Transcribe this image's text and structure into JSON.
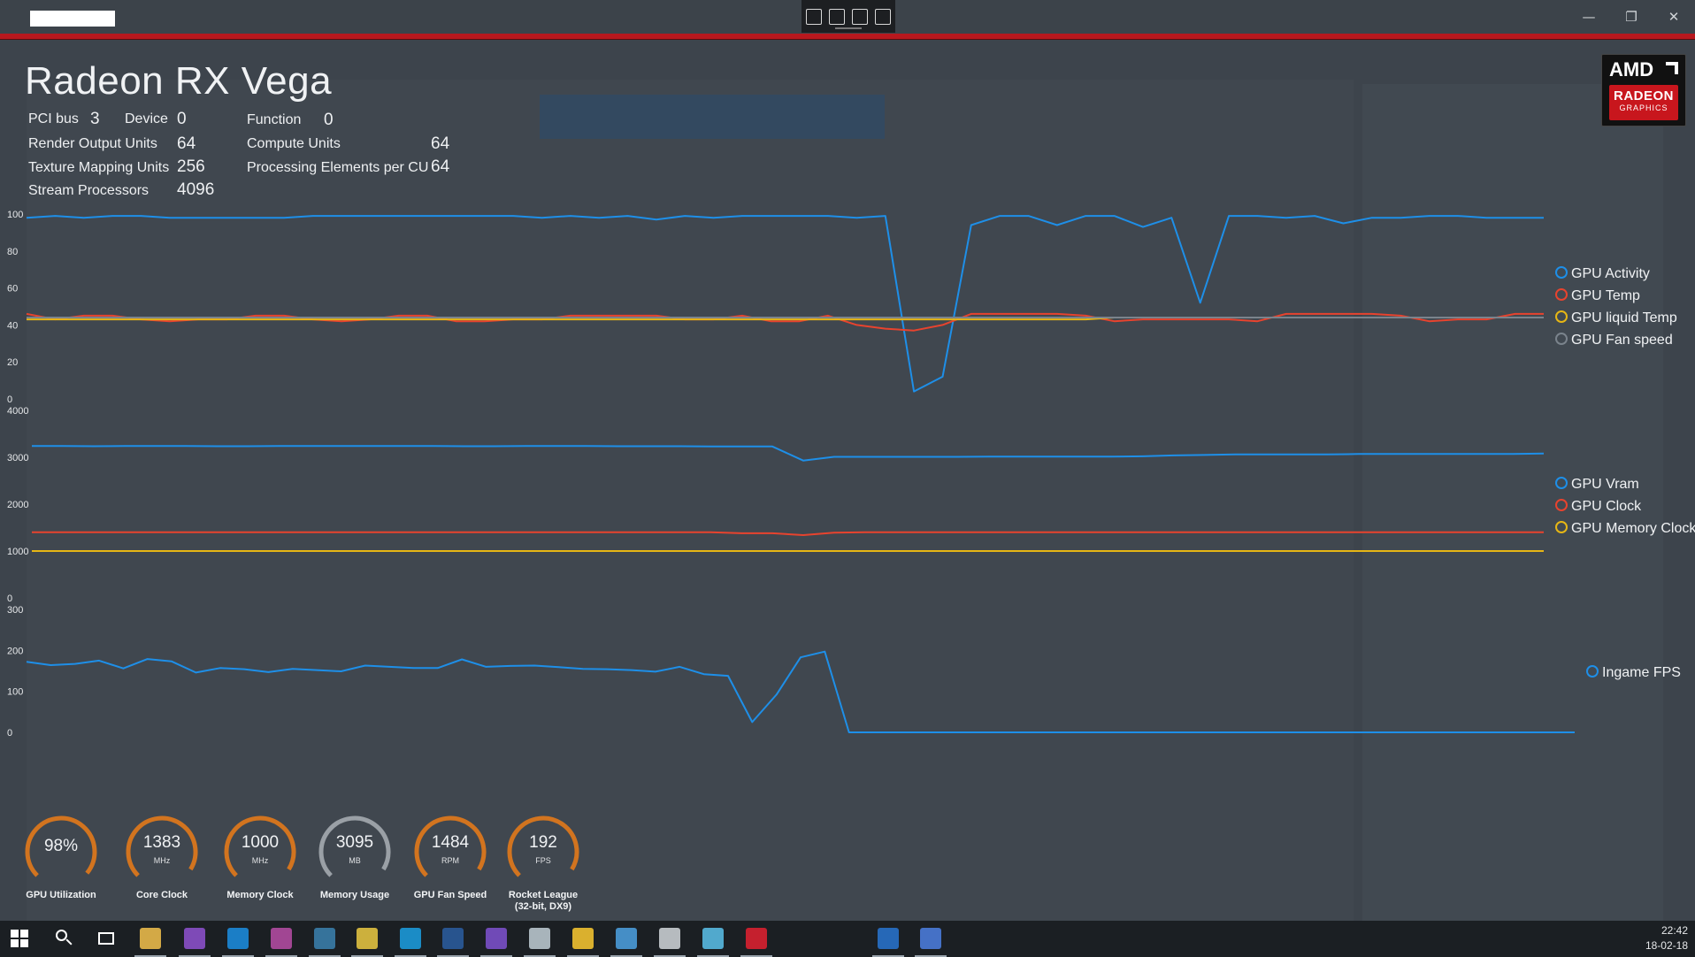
{
  "window": {
    "title": ""
  },
  "header": {
    "gpu_name": "Radeon RX Vega"
  },
  "specs": {
    "pci_bus_label": "PCI bus",
    "pci_bus": "3",
    "device_label": "Device",
    "device": "0",
    "function_label": "Function",
    "function": "0",
    "rop_label": "Render Output Units",
    "rop": "64",
    "cu_label": "Compute Units",
    "cu": "64",
    "tmu_label": "Texture Mapping Units",
    "tmu": "256",
    "pe_label": "Processing Elements per CU",
    "pe": "64",
    "sp_label": "Stream Processors",
    "sp": "4096"
  },
  "logo": {
    "brand": "AMD",
    "product": "RADEON",
    "sub": "GRAPHICS"
  },
  "colors": {
    "blue": "#1e8fe8",
    "red": "#e8432e",
    "yellow": "#e6b615",
    "gray": "#7a838c",
    "gauge_orange": "#d2741f",
    "gauge_gray": "#9aa0a6"
  },
  "chart_data": [
    {
      "type": "line",
      "ylim": [
        0,
        100
      ],
      "yticks": [
        "100",
        "80",
        "60",
        "40",
        "20",
        "0"
      ],
      "series": [
        {
          "name": "GPU Activity",
          "color": "blue",
          "values": [
            98,
            99,
            98,
            99,
            99,
            98,
            98,
            98,
            98,
            98,
            99,
            99,
            99,
            99,
            99,
            99,
            99,
            99,
            98,
            99,
            98,
            99,
            97,
            99,
            98,
            99,
            99,
            99,
            99,
            98,
            99,
            4,
            12,
            94,
            99,
            99,
            94,
            99,
            99,
            93,
            98,
            52,
            99,
            99,
            98,
            99,
            95,
            98,
            98,
            99,
            99,
            98,
            98,
            98
          ]
        },
        {
          "name": "GPU Temp",
          "color": "red",
          "values": [
            46,
            43,
            45,
            45,
            43,
            42,
            43,
            43,
            45,
            45,
            43,
            42,
            43,
            45,
            45,
            42,
            42,
            43,
            43,
            45,
            45,
            45,
            45,
            43,
            43,
            45,
            42,
            42,
            45,
            40,
            38,
            37,
            40,
            46,
            46,
            46,
            46,
            45,
            42,
            43,
            43,
            43,
            43,
            42,
            46,
            46,
            46,
            46,
            45,
            42,
            43,
            43,
            46,
            46
          ]
        },
        {
          "name": "GPU liquid Temp",
          "color": "yellow",
          "values": [
            43,
            43,
            43,
            43,
            43,
            43,
            43,
            43,
            43,
            43,
            43,
            43,
            43,
            43,
            43,
            43,
            43,
            43,
            43,
            43,
            43,
            43,
            43,
            43,
            43,
            43,
            43,
            43,
            43,
            43,
            43,
            43,
            43,
            43,
            43,
            43,
            43,
            43,
            44,
            44,
            44,
            44,
            44,
            44,
            44,
            44,
            44,
            44,
            44,
            44,
            44,
            44,
            44,
            44
          ]
        },
        {
          "name": "GPU Fan speed",
          "color": "gray",
          "values": [
            44,
            44,
            44,
            44,
            44,
            44,
            44,
            44,
            44,
            44,
            44,
            44,
            44,
            44,
            44,
            44,
            44,
            44,
            44,
            44,
            44,
            44,
            44,
            44,
            44,
            44,
            44,
            44,
            44,
            44,
            44,
            44,
            44,
            44,
            44,
            44,
            44,
            44,
            44,
            44,
            44,
            44,
            44,
            44,
            44,
            44,
            44,
            44,
            44,
            44,
            44,
            44,
            44,
            44
          ]
        }
      ]
    },
    {
      "type": "line",
      "ylim": [
        0,
        4000
      ],
      "yticks": [
        "4000",
        "3000",
        "2000",
        "1000",
        "0"
      ],
      "series": [
        {
          "name": "GPU Vram",
          "color": "blue",
          "values": [
            3240,
            3240,
            3235,
            3240,
            3240,
            3240,
            3235,
            3235,
            3240,
            3240,
            3240,
            3240,
            3240,
            3240,
            3235,
            3235,
            3240,
            3240,
            3240,
            3235,
            3235,
            3235,
            3230,
            3230,
            3230,
            2930,
            3010,
            3010,
            3010,
            3010,
            3010,
            3015,
            3015,
            3015,
            3015,
            3015,
            3020,
            3040,
            3050,
            3060,
            3060,
            3060,
            3060,
            3070,
            3070,
            3070,
            3070,
            3070,
            3070,
            3080
          ]
        },
        {
          "name": "GPU Clock",
          "color": "red",
          "values": [
            1400,
            1400,
            1400,
            1400,
            1400,
            1400,
            1400,
            1400,
            1400,
            1400,
            1400,
            1400,
            1400,
            1400,
            1400,
            1400,
            1400,
            1400,
            1400,
            1400,
            1400,
            1400,
            1400,
            1380,
            1380,
            1340,
            1390,
            1400,
            1400,
            1400,
            1400,
            1400,
            1400,
            1400,
            1400,
            1400,
            1400,
            1400,
            1400,
            1400,
            1400,
            1400,
            1400,
            1400,
            1400,
            1400,
            1400,
            1400,
            1400,
            1400
          ]
        },
        {
          "name": "GPU Memory Clock",
          "color": "yellow",
          "values": [
            1000,
            1000,
            1000,
            1000,
            1000,
            1000,
            1000,
            1000,
            1000,
            1000,
            1000,
            1000,
            1000,
            1000,
            1000,
            1000,
            1000,
            1000,
            1000,
            1000,
            1000,
            1000,
            1000,
            1000,
            1000,
            1000,
            1000,
            1000,
            1000,
            1000,
            1000,
            1000,
            1000,
            1000,
            1000,
            1000,
            1000,
            1000,
            1000,
            1000,
            1000,
            1000,
            1000,
            1000,
            1000,
            1000,
            1000,
            1000,
            1000,
            1000
          ]
        }
      ]
    },
    {
      "type": "line",
      "ylim": [
        0,
        300
      ],
      "yticks": [
        "300",
        "200",
        "100",
        "0"
      ],
      "series": [
        {
          "name": "Ingame FPS",
          "color": "blue",
          "values": [
            172,
            164,
            167,
            175,
            156,
            179,
            173,
            146,
            157,
            154,
            147,
            155,
            152,
            149,
            163,
            160,
            157,
            157,
            178,
            160,
            162,
            163,
            159,
            155,
            154,
            152,
            148,
            160,
            142,
            138,
            25,
            92,
            183,
            197,
            0,
            0,
            0,
            0,
            0,
            0,
            0,
            0,
            0,
            0,
            0,
            0,
            0,
            0,
            0,
            0,
            0,
            0,
            0,
            0,
            0,
            0,
            0,
            0,
            0,
            0,
            0,
            0,
            0,
            0,
            0
          ]
        }
      ]
    }
  ],
  "gauges": [
    {
      "value": "98%",
      "unit": "",
      "label": "GPU Utilization",
      "fraction": 0.98,
      "style": "orange"
    },
    {
      "value": "1383",
      "unit": "MHz",
      "label": "Core Clock",
      "fraction": 0.95,
      "style": "orange"
    },
    {
      "value": "1000",
      "unit": "MHz",
      "label": "Memory Clock",
      "fraction": 0.95,
      "style": "orange"
    },
    {
      "value": "3095",
      "unit": "MB",
      "label": "Memory Usage",
      "fraction": 0.95,
      "style": "gray"
    },
    {
      "value": "1484",
      "unit": "RPM",
      "label": "GPU Fan Speed",
      "fraction": 0.95,
      "style": "orange"
    },
    {
      "value": "192",
      "unit": "FPS",
      "label": "Rocket League\n(32-bit, DX9)",
      "fraction": 0.95,
      "style": "orange"
    }
  ],
  "taskbar": {
    "apps": [
      {
        "icon": "windows-start-icon",
        "color": "#ffffff"
      },
      {
        "icon": "search-icon",
        "color": "#ffffff"
      },
      {
        "icon": "task-view-icon",
        "color": "#ffffff"
      },
      {
        "icon": "file-explorer-icon",
        "color": "#e8b84a"
      },
      {
        "icon": "visual-studio-icon",
        "color": "#8a4fc8"
      },
      {
        "icon": "edge-icon",
        "color": "#1c88d8"
      },
      {
        "icon": "app-icon",
        "color": "#b04aa0"
      },
      {
        "icon": "app-icon",
        "color": "#3a7ca8"
      },
      {
        "icon": "app-icon",
        "color": "#e0c040"
      },
      {
        "icon": "app-icon",
        "color": "#1c98d8"
      },
      {
        "icon": "steam-icon",
        "color": "#2a5a9a"
      },
      {
        "icon": "visual-studio-icon",
        "color": "#7a4fc8"
      },
      {
        "icon": "app-icon",
        "color": "#b8c4cc"
      },
      {
        "icon": "app-icon",
        "color": "#f0c030"
      },
      {
        "icon": "app-icon",
        "color": "#4a9ad8"
      },
      {
        "icon": "app-icon",
        "color": "#c8ccd0"
      },
      {
        "icon": "app-icon",
        "color": "#58b8e0"
      },
      {
        "icon": "app-icon",
        "color": "#d82030"
      },
      {
        "icon": "app-icon",
        "color": "#2870c8"
      },
      {
        "icon": "app-icon",
        "color": "#4a7ad8"
      }
    ],
    "time": "22:42",
    "date": "18-02-18"
  }
}
